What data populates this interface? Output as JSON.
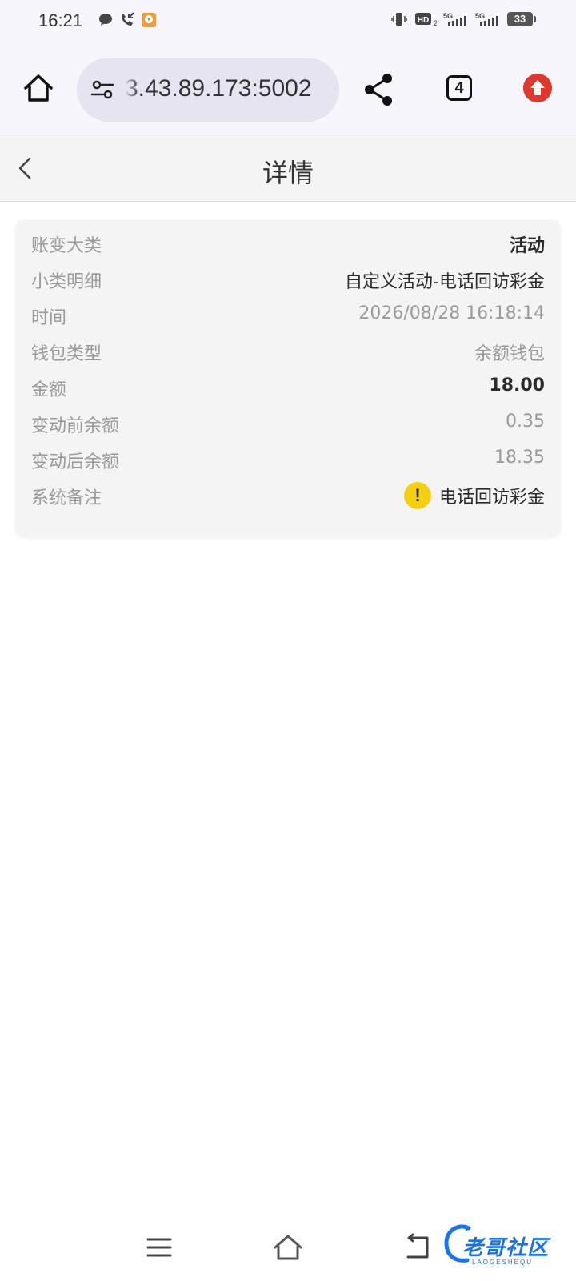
{
  "status_bar": {
    "time": "16:21",
    "battery": "33",
    "network": [
      "HD",
      "5G",
      "5G"
    ]
  },
  "browser": {
    "url": "3.43.89.173:5002",
    "tab_count": "4"
  },
  "header": {
    "title": "详情"
  },
  "details": [
    {
      "label": "账变大类",
      "value": "活动"
    },
    {
      "label": "小类明细",
      "value": "自定义活动-电话回访彩金"
    },
    {
      "label": "时间",
      "value": "2026/08/28 16:18:14"
    },
    {
      "label": "钱包类型",
      "value": "余额钱包"
    },
    {
      "label": "金额",
      "value": "18.00"
    },
    {
      "label": "变动前余额",
      "value": "0.35"
    },
    {
      "label": "变动后余额",
      "value": "18.35"
    },
    {
      "label": "系统备注",
      "value": "电话回访彩金"
    }
  ],
  "remark_icon": "!",
  "watermark": {
    "text": "老哥社区",
    "sub": "LAOGESHEQU"
  },
  "colors": {
    "warning": "#f5d012",
    "update": "#e0382e",
    "watermark": "#1a73e8"
  }
}
